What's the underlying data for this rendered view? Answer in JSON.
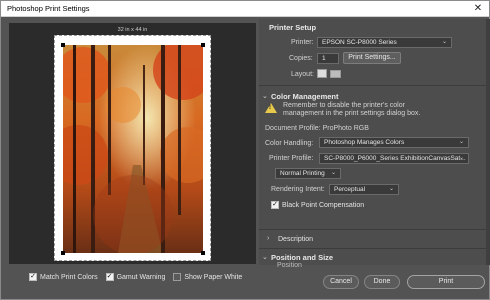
{
  "window": {
    "title": "Photoshop Print Settings",
    "close": "✕"
  },
  "preview": {
    "paper_size": "32 in x 44 in"
  },
  "bottom_checks": [
    {
      "label": "Match Print Colors",
      "checked": true
    },
    {
      "label": "Gamut Warning",
      "checked": true
    },
    {
      "label": "Show Paper White",
      "checked": false
    }
  ],
  "printer_setup": {
    "title": "Printer Setup",
    "printer_label": "Printer:",
    "printer_value": "EPSON SC-P8000 Series",
    "copies_label": "Copies:",
    "copies_value": "1",
    "print_settings_button": "Print Settings...",
    "layout_label": "Layout:"
  },
  "color_management": {
    "title": "Color Management",
    "warning_line1": "Remember to disable the printer's color",
    "warning_line2": "management in the print settings dialog box.",
    "document_profile": "Document Profile: ProPhoto RGB",
    "color_handling_label": "Color Handling:",
    "color_handling_value": "Photoshop Manages Colors",
    "printer_profile_label": "Printer Profile:",
    "printer_profile_value": "SC-P8000_P6000_Series ExhibitionCanvasSat...",
    "print_mode_value": "Normal Printing",
    "rendering_intent_label": "Rendering Intent:",
    "rendering_intent_value": "Perceptual",
    "bpc_label": "Black Point Compensation",
    "bpc_checked": true
  },
  "description": {
    "title": "Description"
  },
  "position_size": {
    "title": "Position and Size",
    "sub": "Position"
  },
  "buttons": {
    "cancel": "Cancel",
    "done": "Done",
    "print": "Print"
  },
  "colors": {
    "panel_bg": "#4d4d4d",
    "preview_bg": "#2b2b2b",
    "warning": "#e6c84a"
  }
}
